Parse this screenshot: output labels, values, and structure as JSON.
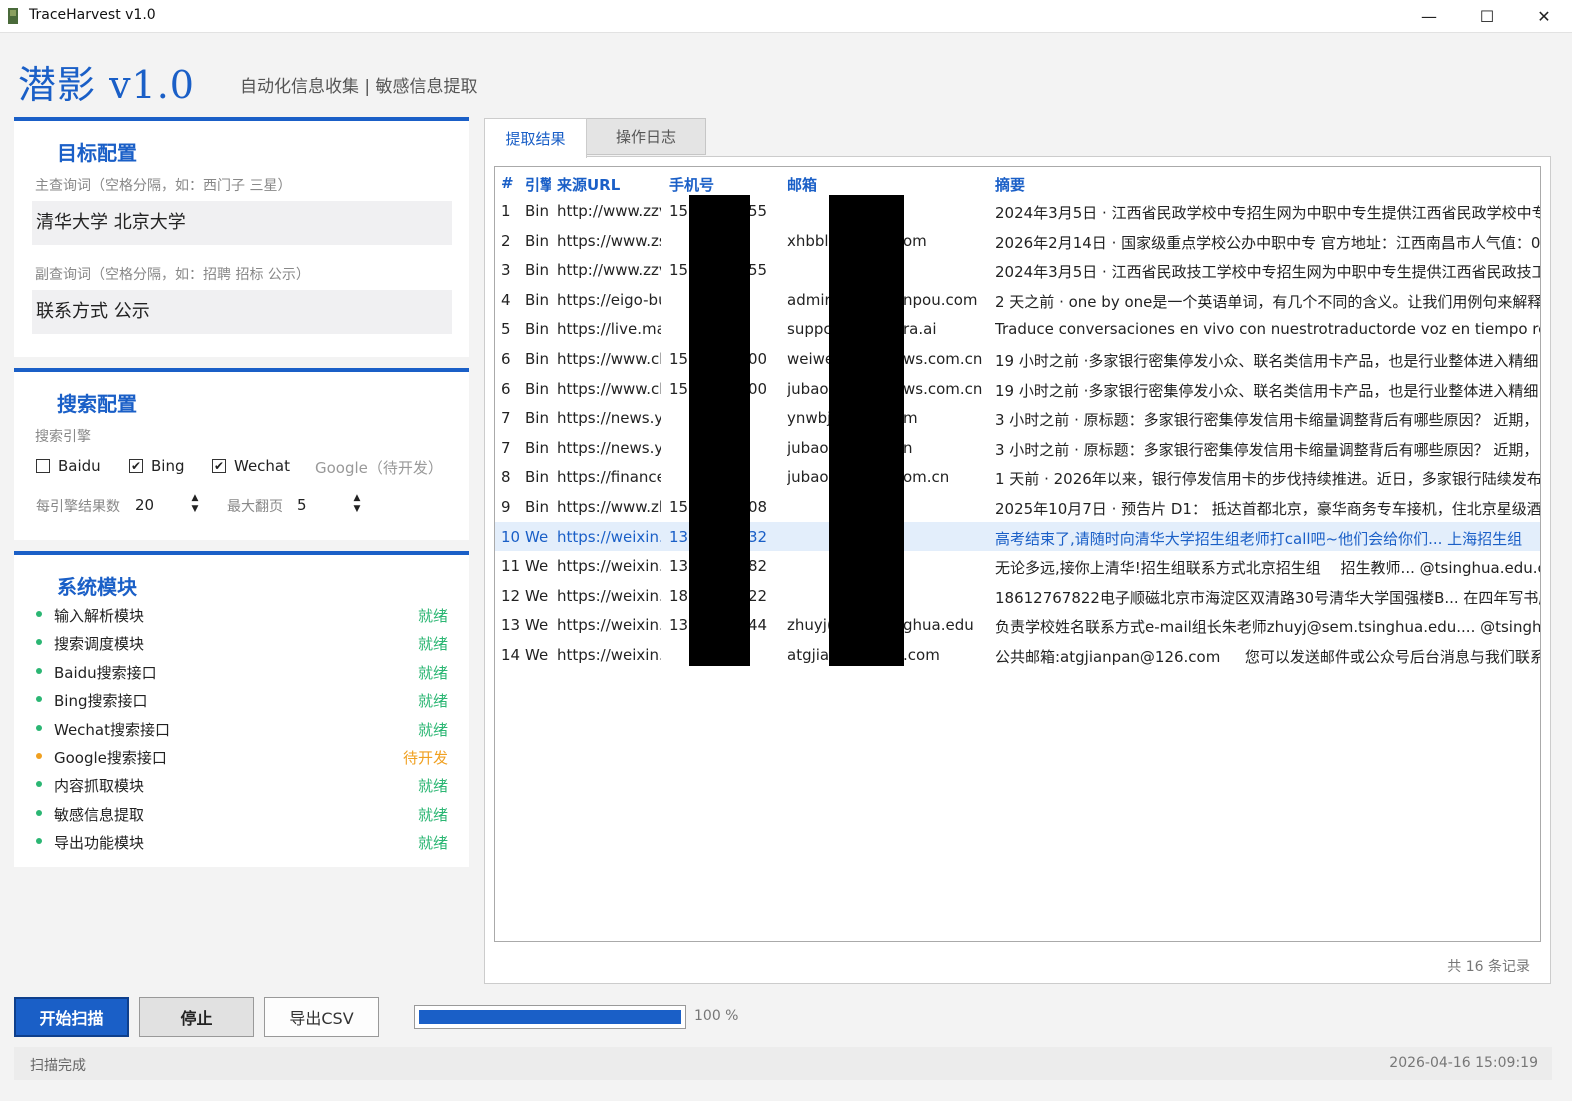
{
  "window": {
    "title": "TraceHarvest v1.0",
    "minimize": "—",
    "maximize": "☐",
    "close": "✕"
  },
  "header": {
    "brand": "潜影 v1.0",
    "subtitle": "自动化信息收集 | 敏感信息提取"
  },
  "target": {
    "title": "目标配置",
    "main_hint": "主查询词（空格分隔，如：西门子 三星）",
    "main_value": "清华大学 北京大学",
    "sub_hint": "副查询词（空格分隔，如：招聘 招标 公示）",
    "sub_value": "联系方式 公示"
  },
  "search": {
    "title": "搜索配置",
    "engine_label": "搜索引擎",
    "engines": [
      {
        "label": "Baidu",
        "checked": false
      },
      {
        "label": "Bing",
        "checked": true
      },
      {
        "label": "Wechat",
        "checked": true
      }
    ],
    "google_label": "Google（待开发）",
    "results_label": "每引擎结果数",
    "results_value": "20",
    "pages_label": "最大翻页",
    "pages_value": "5"
  },
  "modules": {
    "title": "系统模块",
    "ready_color": "#2bb673",
    "pending_color": "#f0a020",
    "items": [
      {
        "name": "输入解析模块",
        "status": "就绪"
      },
      {
        "name": "搜索调度模块",
        "status": "就绪"
      },
      {
        "name": "Baidu搜索接口",
        "status": "就绪"
      },
      {
        "name": "Bing搜索接口",
        "status": "就绪"
      },
      {
        "name": "Wechat搜索接口",
        "status": "就绪"
      },
      {
        "name": "Google搜索接口",
        "status": "待开发"
      },
      {
        "name": "内容抓取模块",
        "status": "就绪"
      },
      {
        "name": "敏感信息提取",
        "status": "就绪"
      },
      {
        "name": "导出功能模块",
        "status": "就绪"
      }
    ]
  },
  "tabs": {
    "results": "提取结果",
    "log": "操作日志"
  },
  "table": {
    "headers": [
      "#",
      "引擎",
      "来源URL",
      "手机号",
      "邮箱",
      "摘要"
    ],
    "rows": [
      [
        "1",
        "Bin",
        "http://www.zzv",
        "15",
        "55",
        "",
        "",
        "2024年3月5日 · 江西省民政学校中专招生网为中职中专生提供江西省民政学校中专"
      ],
      [
        "2",
        "Bin",
        "https://www.zs",
        "",
        "",
        "xhbbl",
        "om",
        "2026年2月14日 · 国家级重点学校公办中职中专 官方地址：江西南昌市人气值：0"
      ],
      [
        "3",
        "Bin",
        "http://www.zzv",
        "15",
        "55",
        "",
        "",
        "2024年3月5日 · 江西省民政技工学校中专招生网为中职中专生提供江西省民政技工"
      ],
      [
        "4",
        "Bin",
        "https://eigo-bu",
        "",
        "",
        "admir",
        "npou.com",
        "2 天之前 · one by one是一个英语单词，有几个不同的含义。让我们用例句来解释"
      ],
      [
        "5",
        "Bin",
        "https://live.ma",
        "",
        "",
        "suppc",
        "ra.ai",
        "Traduce conversaciones en vivo con nuestrotraductorde voz en tiempo real"
      ],
      [
        "6",
        "Bin",
        "https://www.ch",
        "15",
        "00",
        "weiwe",
        "ws.com.cn",
        "19 小时之前 ·多家银行密集停发小众、联名类信用卡产品，也是行业整体进入精细"
      ],
      [
        "6",
        "Bin",
        "https://www.ch",
        "15",
        "00",
        "jubao",
        "ws.com.cn",
        "19 小时之前 ·多家银行密集停发小众、联名类信用卡产品，也是行业整体进入精细"
      ],
      [
        "7",
        "Bin",
        "https://news.yu",
        "",
        "",
        "ynwbj",
        "m",
        "3 小时之前 · 原标题：多家银行密集停发信用卡缩量调整背后有哪些原因？ 近期，"
      ],
      [
        "7",
        "Bin",
        "https://news.yu",
        "",
        "",
        "jubao",
        "n",
        "3 小时之前 · 原标题：多家银行密集停发信用卡缩量调整背后有哪些原因？ 近期，"
      ],
      [
        "8",
        "Bin",
        "https://finance",
        "",
        "",
        "jubao",
        "om.cn",
        "1 天前 · 2026年以来，银行停发信用卡的步伐持续推进。近日，多家银行陆续发布"
      ],
      [
        "9",
        "Bin",
        "https://www.zh",
        "15",
        "08",
        "",
        "",
        "2025年10月7日 · 预告片 D1： 抵达首都北京，豪华商务专车接机，住北京星级酒"
      ],
      [
        "10",
        "We",
        "https://weixin.s",
        "13",
        "32",
        "",
        "",
        "高考结束了,请随时向清华大学招生组老师打call吧~他们会给你们... 上海招生组 　招"
      ],
      [
        "11",
        "We",
        "https://weixin.s",
        "13",
        "82",
        "",
        "",
        "无论多远,接你上清华!招生组联系方式北京招生组 　招生教师... @tsinghua.edu.cn"
      ],
      [
        "12",
        "We",
        "https://weixin.s",
        "18",
        "22",
        "",
        "",
        "18612767822电子顺磁北京市海淀区双清路30号清华大学国强楼B... 在四年写书历"
      ],
      [
        "13",
        "We",
        "https://weixin.s",
        "13",
        "44",
        "zhuyj(",
        "ghua.edu",
        "负责学校姓名联系方式e-mail组长朱老师zhuyj@sem.tsinghua.edu.... @tsinghua"
      ],
      [
        "14",
        "We",
        "https://weixin.s",
        "",
        "",
        "atgjia",
        ".com",
        "公共邮箱:atgjianpan@126.com 　 您可以发送邮件或公众号后台消息与我们联系."
      ]
    ],
    "selected_index": 11,
    "count_label": "共 16 条记录"
  },
  "actions": {
    "start": "开始扫描",
    "stop": "停止",
    "export": "导出CSV"
  },
  "progress": {
    "value": 100,
    "label": "100 %"
  },
  "status": {
    "message": "扫描完成",
    "timestamp": "2026-04-16 15:09:19"
  }
}
